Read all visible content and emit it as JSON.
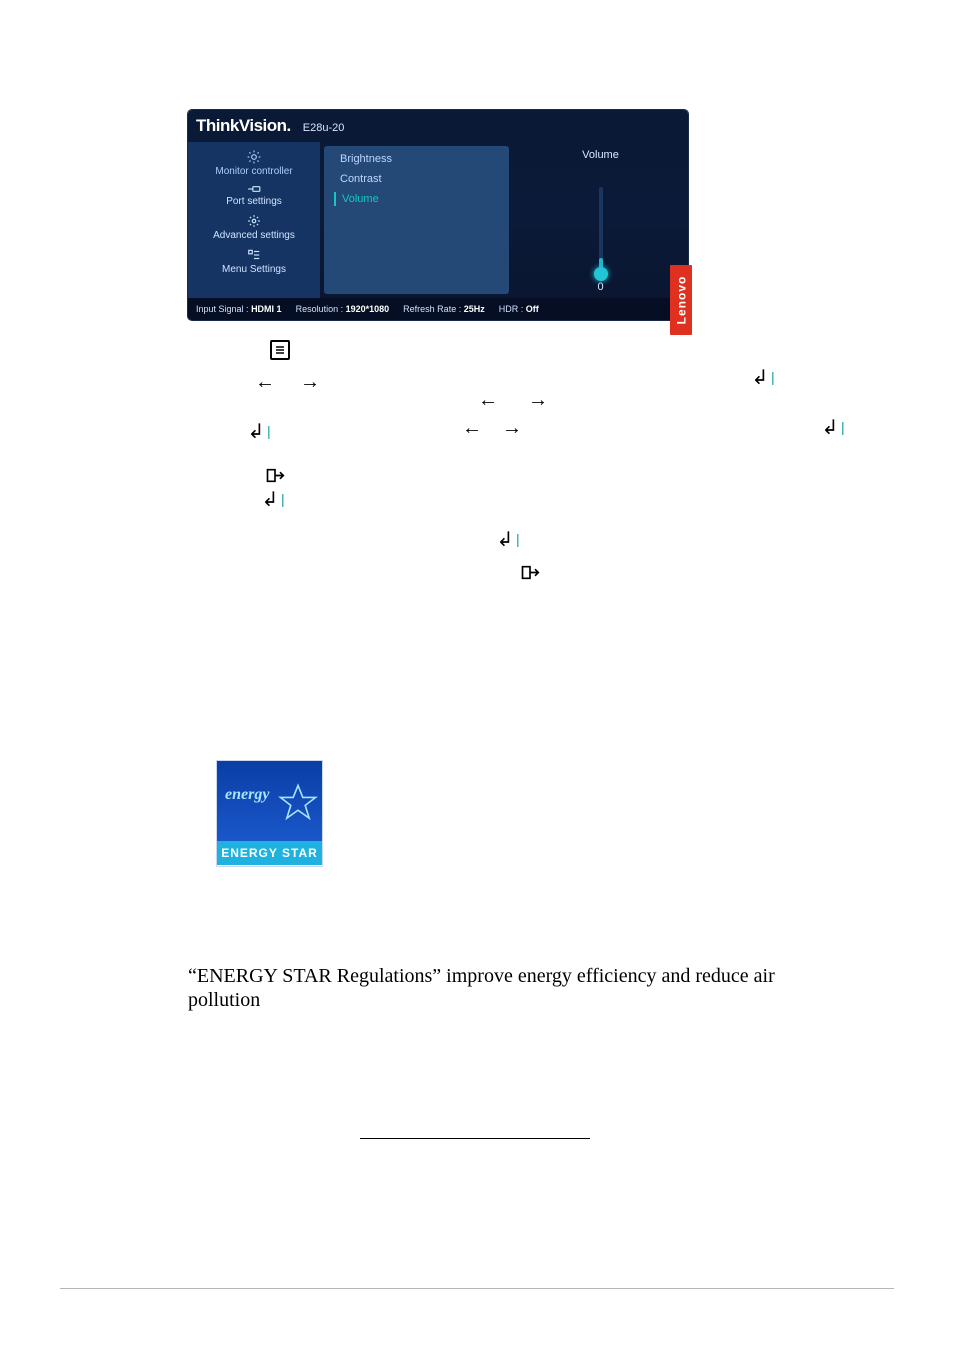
{
  "osd": {
    "brand": "ThinkVision.",
    "model": "E28u-20",
    "sidebar": [
      {
        "label": "Monitor controller"
      },
      {
        "label": "Port settings"
      },
      {
        "label": "Advanced settings"
      },
      {
        "label": "Menu Settings"
      }
    ],
    "submenu": [
      {
        "label": "Brightness"
      },
      {
        "label": "Contrast"
      },
      {
        "label": "Volume"
      }
    ],
    "volume": {
      "label": "Volume",
      "value": "0"
    },
    "status": {
      "input_label": "Input Signal :",
      "input_value": "HDMI 1",
      "res_label": "Resolution :",
      "res_value": "1920*1080",
      "rate_label": "Refresh Rate :",
      "rate_value": "25Hz",
      "hdr_label": "HDR :",
      "hdr_value": "Off"
    },
    "lenovo": "Lenovo"
  },
  "energy_star": {
    "script": "energy",
    "bar": "ENERGY STAR"
  },
  "body_text": "“ENERGY STAR Regulations” improve energy efficiency and reduce air pollution"
}
